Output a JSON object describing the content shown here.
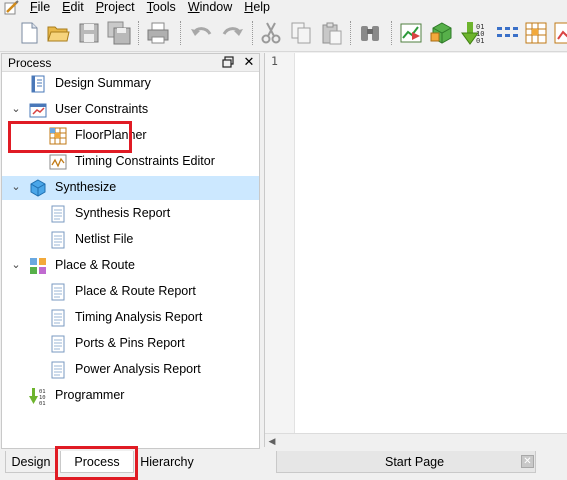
{
  "menubar": {
    "items": [
      {
        "label": "File",
        "mnemonic": "F"
      },
      {
        "label": "Edit",
        "mnemonic": "E"
      },
      {
        "label": "Project",
        "mnemonic": "P"
      },
      {
        "label": "Tools",
        "mnemonic": "T"
      },
      {
        "label": "Window",
        "mnemonic": "W"
      },
      {
        "label": "Help",
        "mnemonic": "H"
      }
    ]
  },
  "toolbar": {
    "buttons": [
      "new-file-icon",
      "open-folder-icon",
      "save-icon",
      "save-all-icon",
      "print-icon",
      "undo-icon",
      "redo-icon",
      "cut-icon",
      "copy-icon",
      "paste-icon",
      "find-icon",
      "design-summary-icon",
      "synthesize-icon",
      "implement-icon",
      "programmer-icon",
      "floorplanner-icon",
      "report-icon"
    ]
  },
  "process_panel": {
    "title": "Process",
    "float_icon": "float-window-icon",
    "close_glyph": "✕",
    "items": [
      {
        "label": "Design Summary",
        "icon": "design-summary-icon",
        "level": 0
      },
      {
        "label": "User Constraints",
        "icon": "constraints-icon",
        "level": 0,
        "expanded": true
      },
      {
        "label": "FloorPlanner",
        "icon": "floorplanner-icon",
        "level": 1
      },
      {
        "label": "Timing Constraints Editor",
        "icon": "timing-editor-icon",
        "level": 1
      },
      {
        "label": "Synthesize",
        "icon": "synthesize-icon",
        "level": 0,
        "expanded": true,
        "selected": true
      },
      {
        "label": "Synthesis Report",
        "icon": "report-icon",
        "level": 1
      },
      {
        "label": "Netlist File",
        "icon": "report-icon",
        "level": 1
      },
      {
        "label": "Place & Route",
        "icon": "place-route-icon",
        "level": 0,
        "expanded": true
      },
      {
        "label": "Place & Route Report",
        "icon": "report-icon",
        "level": 1
      },
      {
        "label": "Timing Analysis Report",
        "icon": "report-icon",
        "level": 1
      },
      {
        "label": "Ports & Pins Report",
        "icon": "report-icon",
        "level": 1
      },
      {
        "label": "Power Analysis Report",
        "icon": "report-icon",
        "level": 1
      },
      {
        "label": "Programmer",
        "icon": "programmer-icon",
        "level": 0
      }
    ]
  },
  "bottom_tabs": {
    "design": "Design",
    "process": "Process",
    "hierarchy": "Hierarchy",
    "active": "Process"
  },
  "editor": {
    "line_numbers": [
      "1"
    ],
    "tab_label": "Start Page",
    "tab_close": "✕"
  },
  "highlight_color": "#e01b24",
  "selection_color": "#cce8ff"
}
